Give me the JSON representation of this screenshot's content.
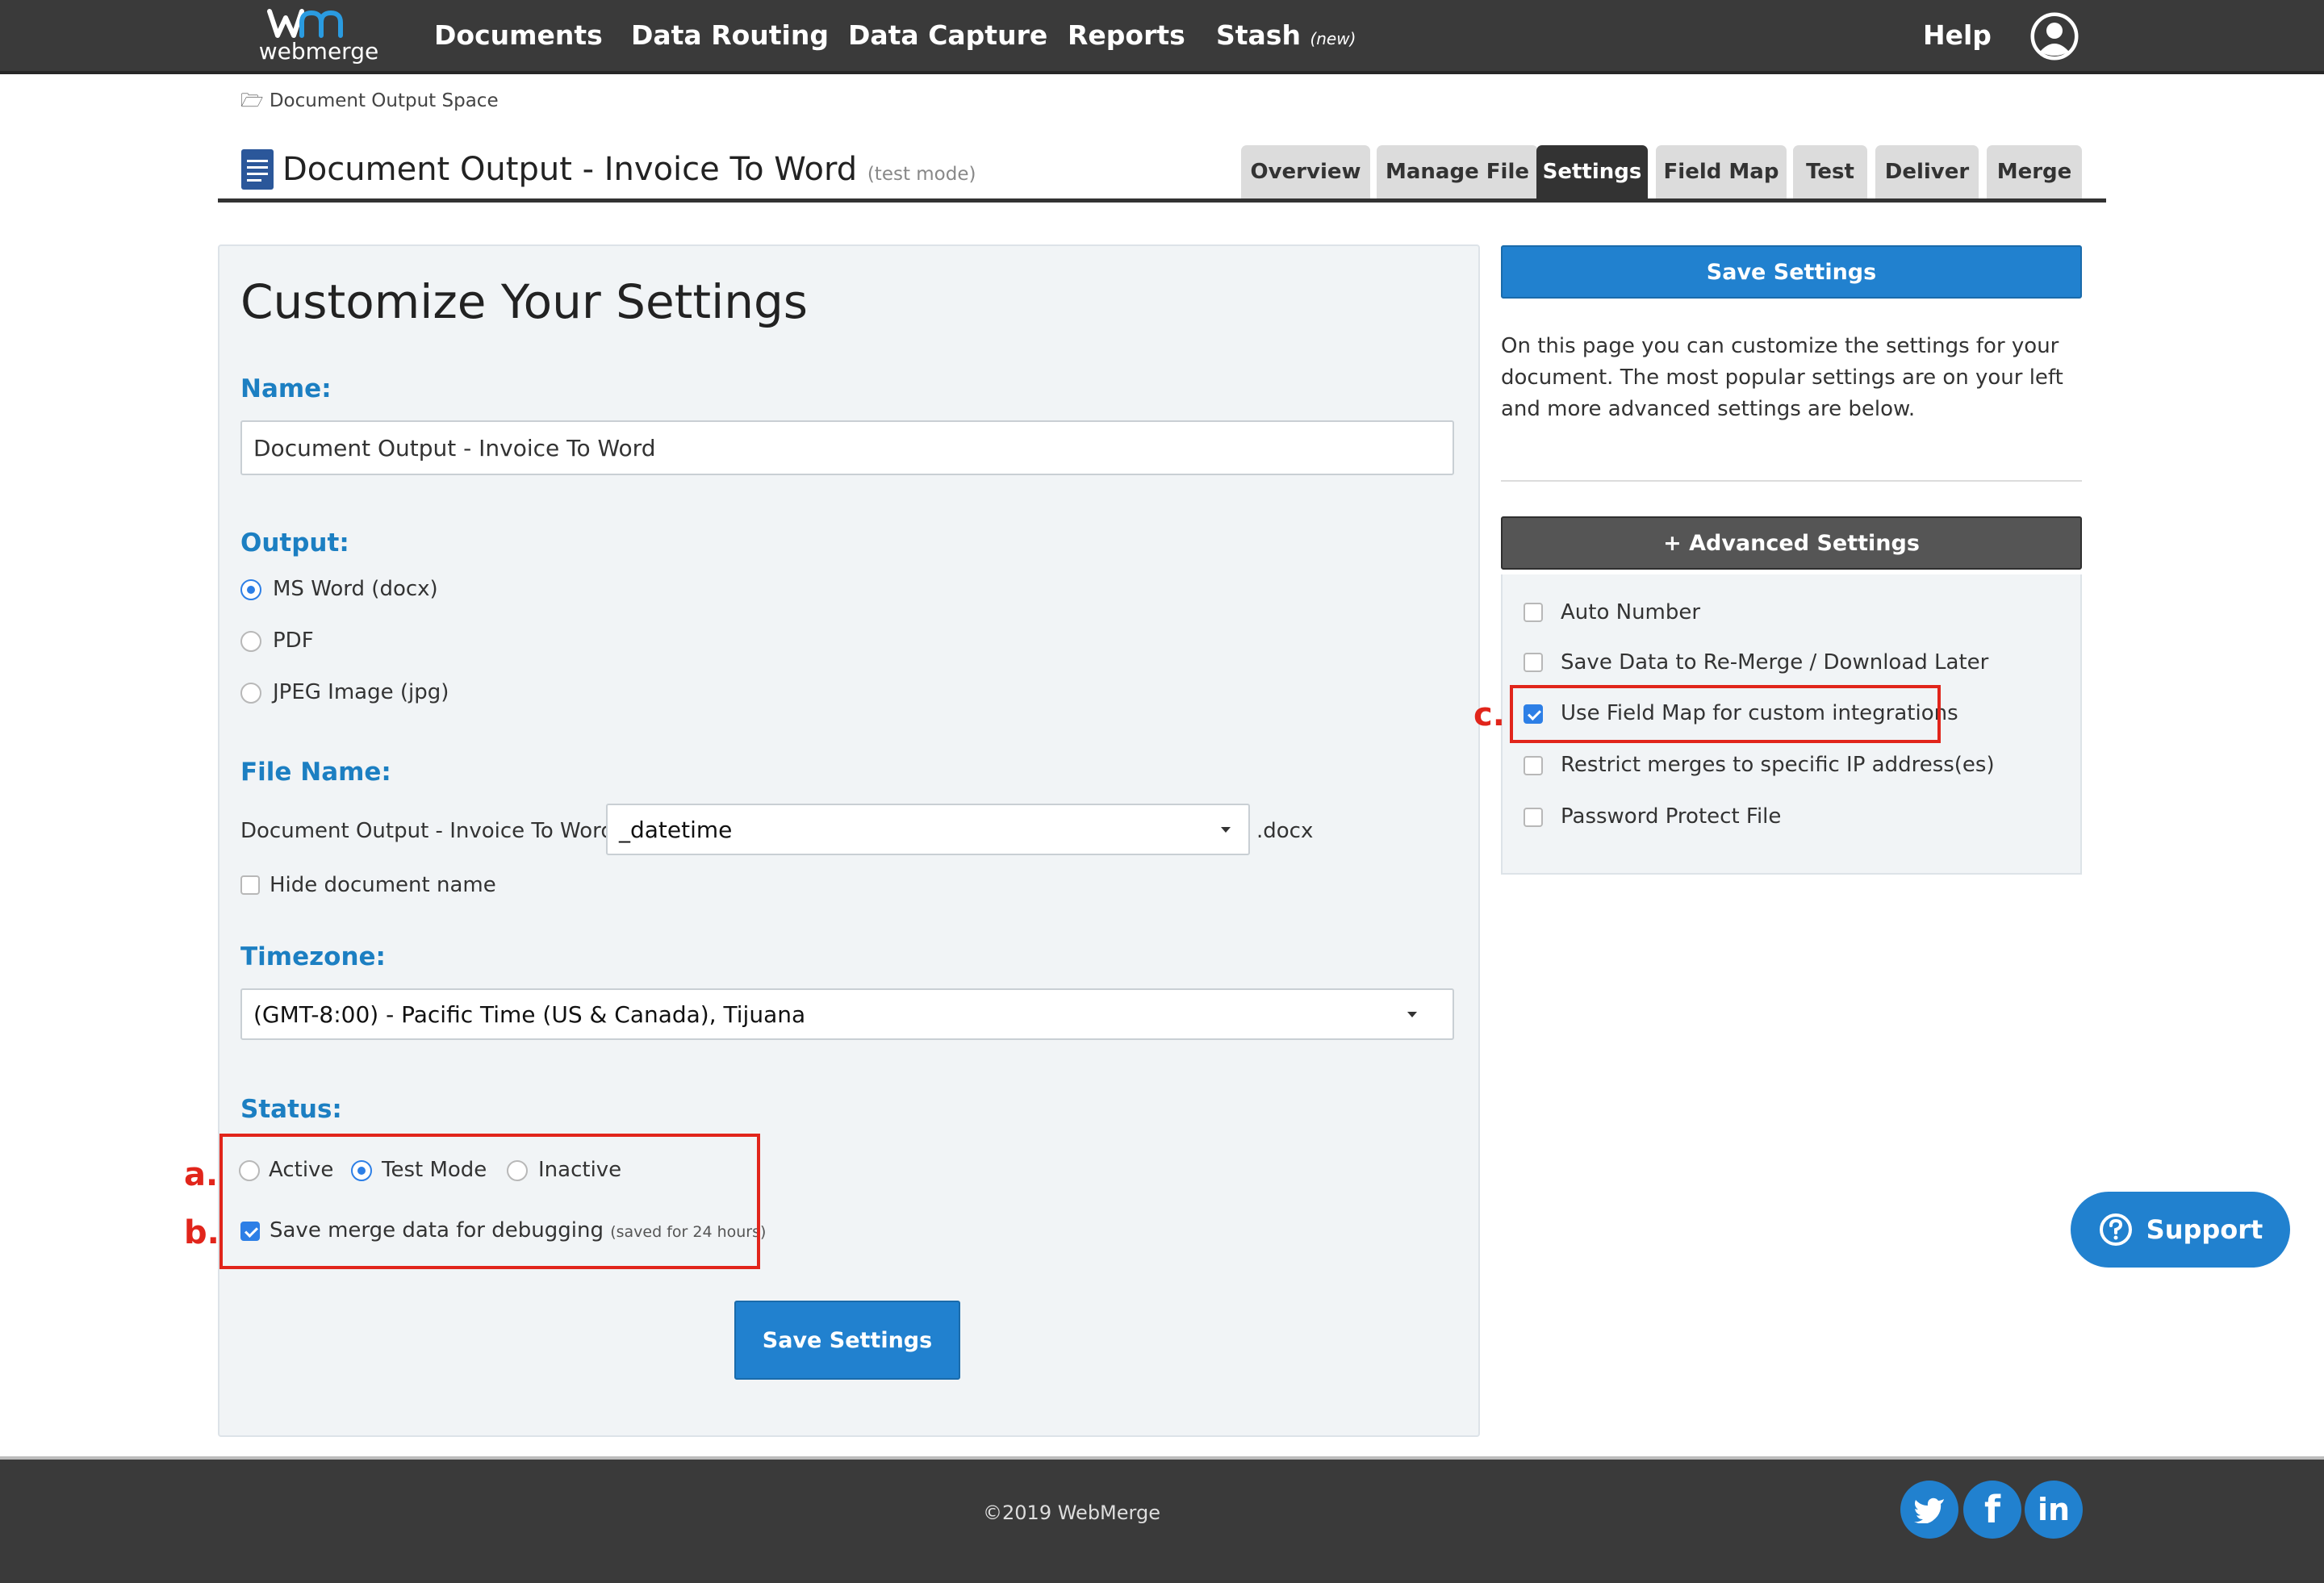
{
  "nav": {
    "logo_text": "webmerge",
    "items": [
      {
        "label": "Documents"
      },
      {
        "label": "Data Routing"
      },
      {
        "label": "Data Capture"
      },
      {
        "label": "Reports"
      },
      {
        "label": "Stash",
        "badge": "(new)"
      }
    ],
    "help": "Help"
  },
  "breadcrumb": "Document Output Space",
  "doc": {
    "title": "Document Output - Invoice To Word",
    "mode_note": "(test mode)"
  },
  "tabs": [
    {
      "label": "Overview"
    },
    {
      "label": "Manage File"
    },
    {
      "label": "Settings",
      "active": true
    },
    {
      "label": "Field Map"
    },
    {
      "label": "Test"
    },
    {
      "label": "Deliver"
    },
    {
      "label": "Merge"
    }
  ],
  "settings": {
    "heading": "Customize Your Settings",
    "name_label": "Name:",
    "name_value": "Document Output - Invoice To Word",
    "output_label": "Output:",
    "output_options": [
      {
        "label": "MS Word (docx)",
        "selected": true
      },
      {
        "label": "PDF",
        "selected": false
      },
      {
        "label": "JPEG Image (jpg)",
        "selected": false
      }
    ],
    "filename_label": "File Name:",
    "filename_prefix": "Document Output - Invoice To Word -",
    "filename_suffix_selected": "_datetime",
    "filename_ext": ".docx",
    "hide_name_label": "Hide document name",
    "hide_name_checked": false,
    "timezone_label": "Timezone:",
    "timezone_value": "(GMT-8:00) - Pacific Time (US & Canada), Tijuana",
    "status_label": "Status:",
    "status_options": [
      {
        "label": "Active",
        "selected": false
      },
      {
        "label": "Test Mode",
        "selected": true
      },
      {
        "label": "Inactive",
        "selected": false
      }
    ],
    "debug_label": "Save merge data for debugging",
    "debug_note": "(saved for 24 hours)",
    "debug_checked": true,
    "save_button": "Save Settings"
  },
  "sidebar": {
    "save_button": "Save Settings",
    "description": "On this page you can customize the settings for your document. The most popular settings are on your left and more advanced settings are below.",
    "advanced_button": "+ Advanced Settings",
    "advanced_options": [
      {
        "label": "Auto Number",
        "checked": false
      },
      {
        "label": "Save Data to Re-Merge / Download Later",
        "checked": false
      },
      {
        "label": "Use Field Map for custom integrations",
        "checked": true
      },
      {
        "label": "Restrict merges to specific IP address(es)",
        "checked": false
      },
      {
        "label": "Password Protect File",
        "checked": false
      }
    ]
  },
  "annotations": {
    "a": "a.",
    "b": "b.",
    "c": "c."
  },
  "support_label": "Support",
  "footer": {
    "copyright": "©2019 WebMerge",
    "social": [
      "twitter-icon",
      "facebook-icon",
      "linkedin-icon"
    ]
  },
  "colors": {
    "topbar": "#3a3a3a",
    "accent_blue": "#2181cf",
    "label_blue": "#1c7fc2",
    "annotation_red": "#e1251b"
  }
}
